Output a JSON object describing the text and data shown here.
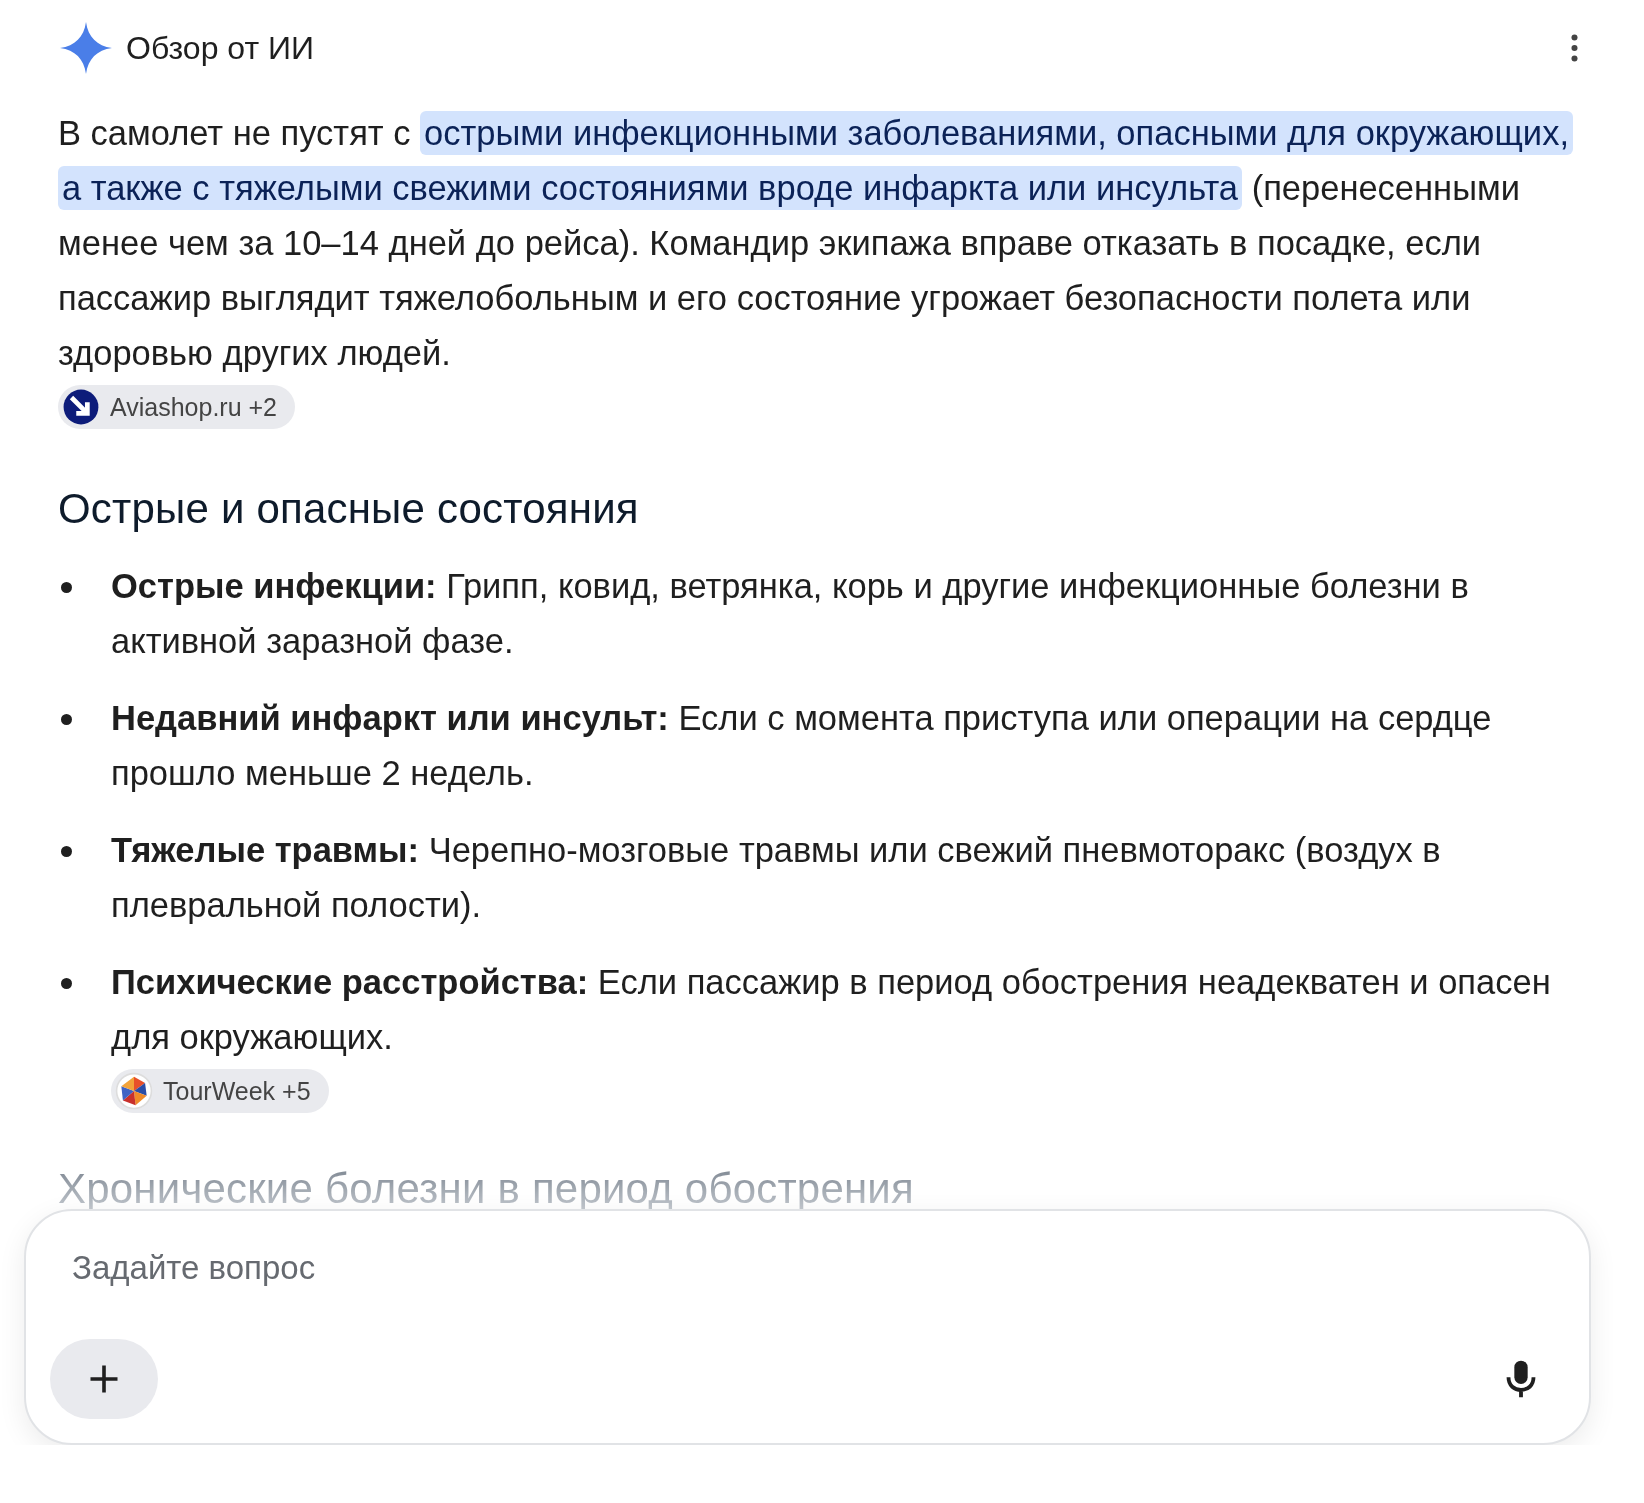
{
  "header": {
    "title": "Обзор от ИИ"
  },
  "intro": {
    "segments": [
      {
        "text": "В самолет не пустят с ",
        "highlighted": false
      },
      {
        "text": "острыми инфекционными заболеваниями, опасными для окружающих, а также с тяжелыми свежими состояниями вроде инфаркта или инсульта",
        "highlighted": true
      },
      {
        "text": " (перенесенными менее чем за 10–14 дней до рейса). Командир экипажа вправе отказать в посадке, если пассажир выглядит тяжелобольным и его состояние угрожает безопасности полета или здоровью других людей.",
        "highlighted": false
      }
    ],
    "source": {
      "label": "Aviashop.ru +2",
      "kind": "arrow"
    }
  },
  "sections": [
    {
      "heading": "Острые и опасные состояния",
      "faded": false,
      "items": [
        {
          "text": "**Острые инфекции:** Грипп, ковид, ветрянка, корь и другие инфекционные болезни в активной заразной фазе."
        },
        {
          "text": "**Недавний инфаркт или инсульт:** Если с момента приступа или операции на сердце прошло меньше 2 недель."
        },
        {
          "text": "**Тяжелые травмы:** Черепно-мозговые травмы или свежий пневмоторакс (воздух в плевральной полости)."
        },
        {
          "text": "**Психические расстройства:** Если пассажир в период обострения неадекватен и опасен для окружающих.",
          "source": {
            "label": "TourWeek +5",
            "kind": "umbrella"
          }
        }
      ]
    },
    {
      "heading": "Хронические болезни в период обострения",
      "faded": true
    }
  ],
  "ask": {
    "placeholder": "Задайте вопрос"
  }
}
